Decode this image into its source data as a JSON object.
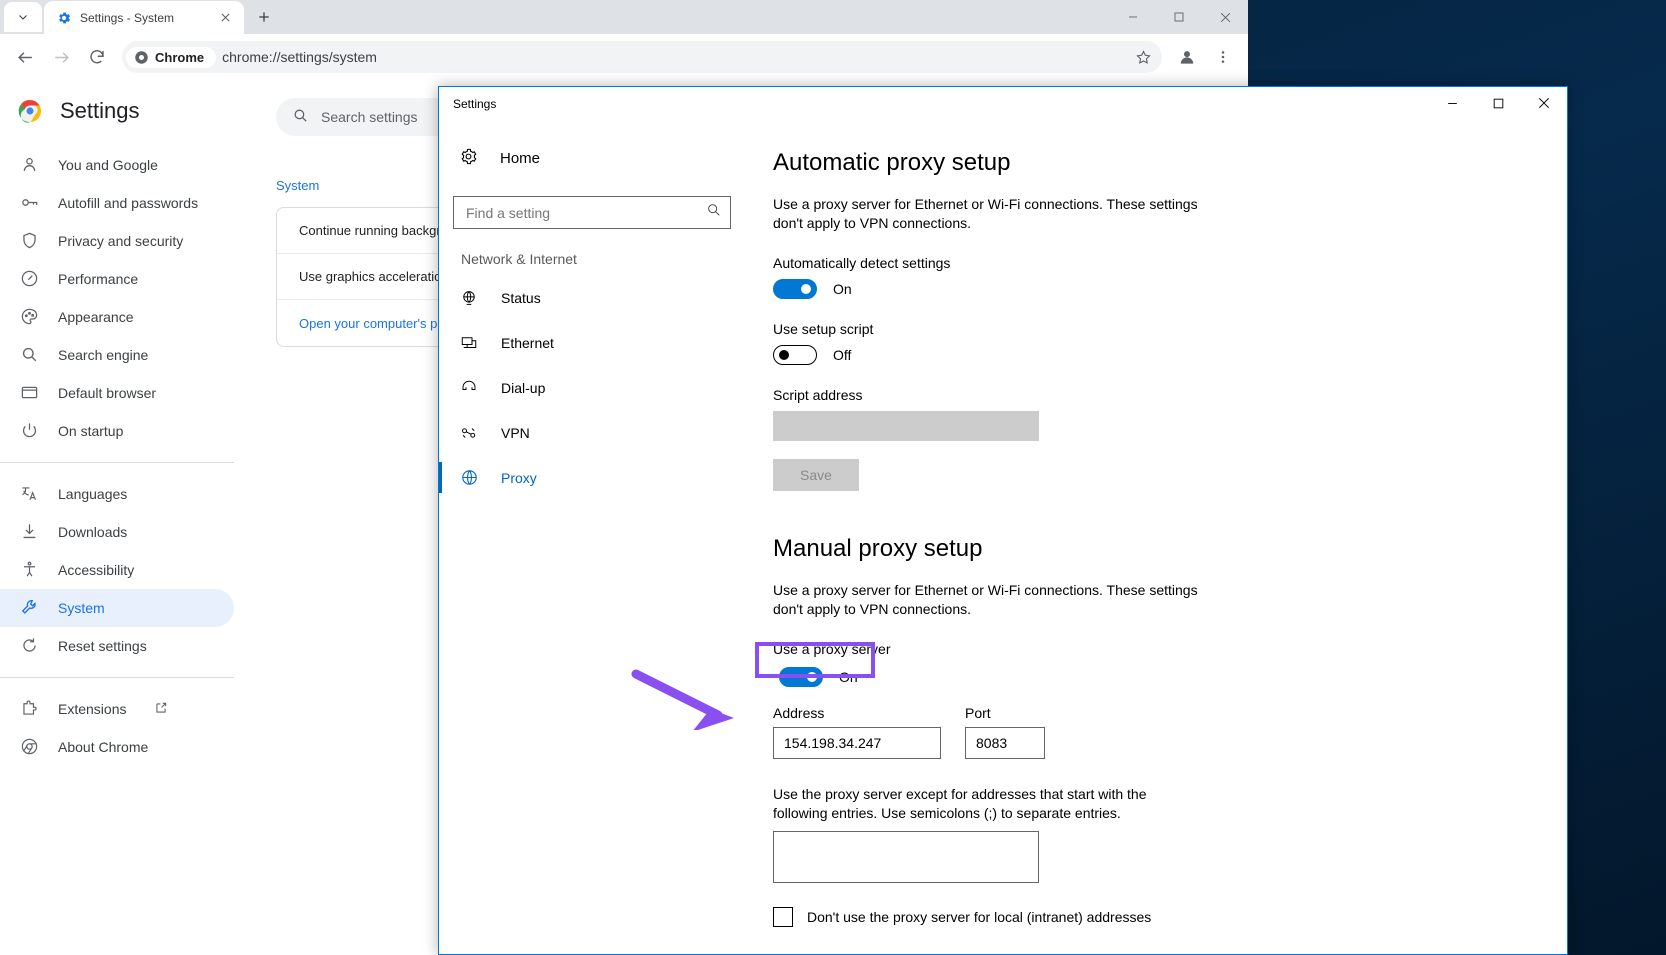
{
  "browser": {
    "tab": {
      "title": "Settings - System",
      "favicon": "chrome-settings-gear-icon"
    },
    "new_tab_label": "+",
    "window_controls": {
      "minimize": "minimize-icon",
      "maximize": "maximize-icon",
      "close": "close-icon"
    },
    "toolbar": {
      "back": "back-arrow-icon",
      "forward": "forward-arrow-icon",
      "reload": "reload-icon",
      "chip_label": "Chrome",
      "url": "chrome://settings/system",
      "bookmark": "star-icon",
      "profile": "profile-avatar-icon",
      "menu": "three-dot-menu-icon"
    }
  },
  "chrome_settings": {
    "brand_title": "Settings",
    "search_placeholder": "Search settings",
    "sidebar_items": [
      {
        "label": "You and Google",
        "icon": "person-icon",
        "active": false
      },
      {
        "label": "Autofill and passwords",
        "icon": "key-icon",
        "active": false
      },
      {
        "label": "Privacy and security",
        "icon": "shield-icon",
        "active": false
      },
      {
        "label": "Performance",
        "icon": "speedometer-icon",
        "active": false
      },
      {
        "label": "Appearance",
        "icon": "palette-icon",
        "active": false
      },
      {
        "label": "Search engine",
        "icon": "search-icon",
        "active": false
      },
      {
        "label": "Default browser",
        "icon": "browser-window-icon",
        "active": false
      },
      {
        "label": "On startup",
        "icon": "power-icon",
        "active": false
      }
    ],
    "sidebar_items_2": [
      {
        "label": "Languages",
        "icon": "translate-icon",
        "active": false
      },
      {
        "label": "Downloads",
        "icon": "download-icon",
        "active": false
      },
      {
        "label": "Accessibility",
        "icon": "accessibility-icon",
        "active": false
      },
      {
        "label": "System",
        "icon": "wrench-icon",
        "active": true
      },
      {
        "label": "Reset settings",
        "icon": "restore-icon",
        "active": false
      }
    ],
    "sidebar_items_3": [
      {
        "label": "Extensions",
        "icon": "extension-icon",
        "external": true
      },
      {
        "label": "About Chrome",
        "icon": "chrome-logo-icon",
        "external": false
      }
    ],
    "section_label": "System",
    "rows": [
      {
        "label": "Continue running background apps when Google Chrome is closed",
        "link": false
      },
      {
        "label": "Use graphics acceleration when available",
        "link": false
      },
      {
        "label": "Open your computer's proxy settings",
        "link": true
      }
    ]
  },
  "win_settings": {
    "title": "Settings",
    "window_controls": {
      "minimize": "minimize-icon",
      "maximize": "maximize-icon",
      "close": "close-icon"
    },
    "home_label": "Home",
    "search_placeholder": "Find a setting",
    "search_value": "",
    "search_icon": "search-icon",
    "group_label": "Network & Internet",
    "nav_items": [
      {
        "label": "Status",
        "icon": "globe-status-icon",
        "active": false
      },
      {
        "label": "Ethernet",
        "icon": "ethernet-icon",
        "active": false
      },
      {
        "label": "Dial-up",
        "icon": "dialup-phone-icon",
        "active": false
      },
      {
        "label": "VPN",
        "icon": "vpn-icon",
        "active": false
      },
      {
        "label": "Proxy",
        "icon": "globe-icon",
        "active": true
      }
    ],
    "automatic": {
      "heading": "Automatic proxy setup",
      "description": "Use a proxy server for Ethernet or Wi-Fi connections. These settings don't apply to VPN connections.",
      "auto_detect_label": "Automatically detect settings",
      "auto_detect_state": "On",
      "auto_detect_on": true,
      "setup_script_label": "Use setup script",
      "setup_script_state": "Off",
      "setup_script_on": false,
      "script_address_label": "Script address",
      "script_address_value": "",
      "save_label": "Save"
    },
    "manual": {
      "heading": "Manual proxy setup",
      "description": "Use a proxy server for Ethernet or Wi-Fi connections. These settings don't apply to VPN connections.",
      "use_proxy_label": "Use a proxy server",
      "use_proxy_state": "On",
      "use_proxy_on": true,
      "address_label": "Address",
      "address_value": "154.198.34.247",
      "port_label": "Port",
      "port_value": "8083",
      "exceptions_description": "Use the proxy server except for addresses that start with the following entries. Use semicolons (;) to separate entries.",
      "exceptions_value": "",
      "local_bypass_label": "Don't use the proxy server for local (intranet) addresses",
      "local_bypass_checked": false
    }
  },
  "annotations": {
    "highlight_color": "#8a4ff0",
    "highlight_target": "use-a-proxy-server-toggle",
    "arrow_target": "proxy-address-field"
  }
}
